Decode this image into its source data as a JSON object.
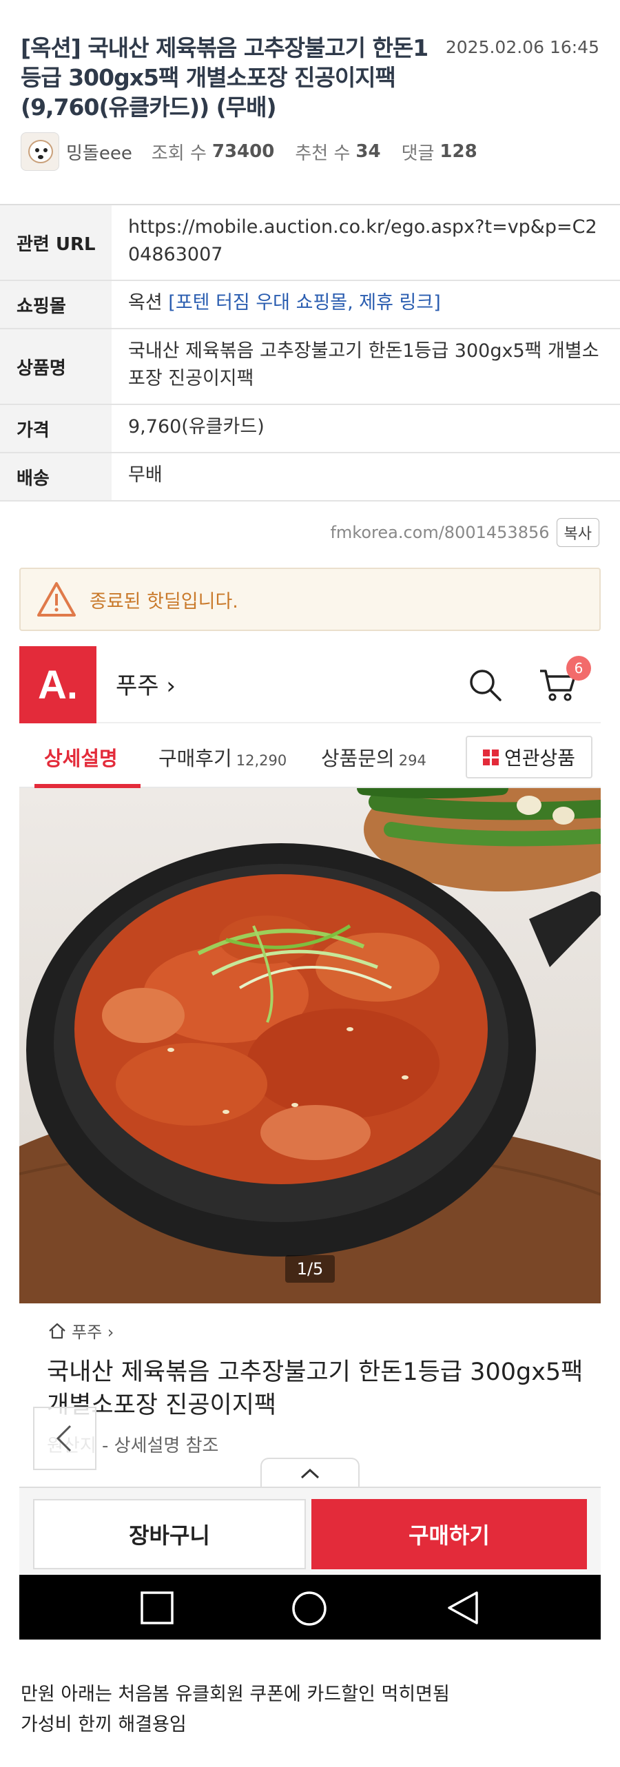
{
  "post": {
    "title": "[옥션] 국내산 제육볶음 고추장불고기 한돈1등급 300gx5팩 개별소포장 진공이지팩 (9,760(유클카드)) (무배)",
    "date": "2025.02.06 16:45",
    "author": "밍돌eee",
    "views_label": "조회 수",
    "views": "73400",
    "likes_label": "추천 수",
    "likes": "34",
    "comments_label": "댓글",
    "comments": "128"
  },
  "info": {
    "url_label": "관련 URL",
    "url_value": "https://mobile.auction.co.kr/ego.aspx?t=vp&p=C204863007",
    "mall_label": "쇼핑몰",
    "mall_value": "옥션",
    "mall_link": "[포텐 터짐 우대 쇼핑몰, 제휴 링크]",
    "product_label": "상품명",
    "product_value": "국내산 제육볶음 고추장불고기 한돈1등급 300gx5팩 개별소포장 진공이지팩",
    "price_label": "가격",
    "price_value": "9,760(유클카드)",
    "shipping_label": "배송",
    "shipping_value": "무배"
  },
  "permalink": {
    "url": "fmkorea.com/8001453856",
    "copy_label": "복사"
  },
  "notice": {
    "ended": "종료된 핫딜입니다."
  },
  "screenshot": {
    "logo": "A.",
    "store": "푸주 ›",
    "cart_count": "6",
    "tabs": [
      {
        "label": "상세설명",
        "count": ""
      },
      {
        "label": "구매후기",
        "count": "12,290"
      },
      {
        "label": "상품문의",
        "count": "294"
      }
    ],
    "related_label": "연관상품",
    "photo_counter": "1/5",
    "breadcrumb": "푸주 ›",
    "product_name": "국내산 제육볶음 고추장불고기 한돈1등급 300gx5팩 개별소포장 진공이지팩",
    "origin": "원산지 - 상세설명 참조",
    "cart_button": "장바구니",
    "buy_button": "구매하기"
  },
  "comment": {
    "line1": "만원 아래는 처음봄 유클회원 쿠폰에 카드할인 먹히면됨",
    "line2": "가성비 한끼 해결용임"
  }
}
